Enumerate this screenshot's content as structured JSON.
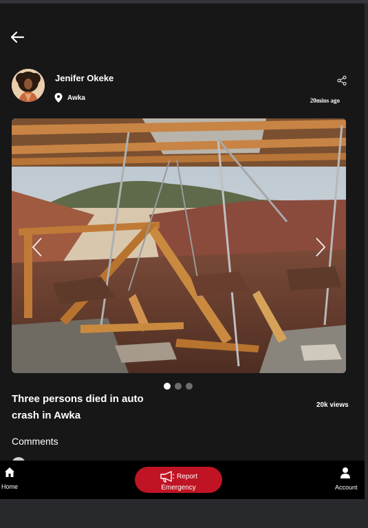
{
  "post": {
    "author_name": "Jenifer Okeke",
    "location": "Awka",
    "time_ago": "20mins ago",
    "title": "Three persons died in auto crash in Awka",
    "views": "20k views",
    "carousel": {
      "total_slides": 3,
      "active_slide": 1
    }
  },
  "comments": {
    "heading": "Comments"
  },
  "bottom_nav": {
    "home_label": "Home",
    "report_line1": "Report",
    "report_line2": "Emergency",
    "account_label": "Account"
  },
  "icons": {
    "back": "arrow-left-icon",
    "location": "map-pin-icon",
    "share": "share-icon",
    "prev": "chevron-left-icon",
    "next": "chevron-right-icon",
    "home": "home-icon",
    "report": "megaphone-icon",
    "account": "user-icon"
  },
  "colors": {
    "background": "#171718",
    "report_button": "#c01424",
    "nav_bar": "#000000",
    "dot_active": "#ffffff",
    "dot_inactive": "#6d6d70"
  }
}
